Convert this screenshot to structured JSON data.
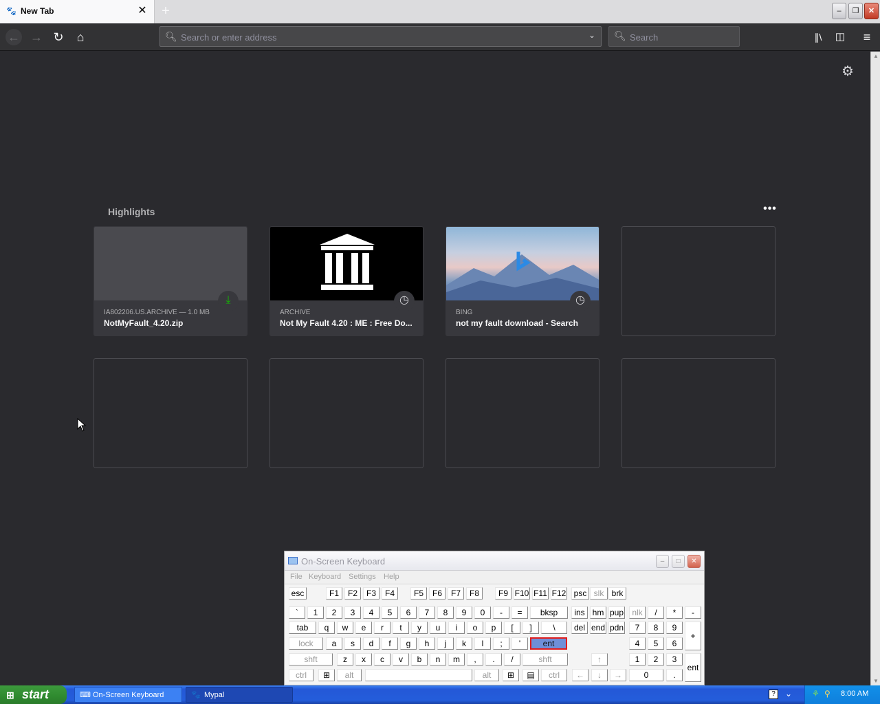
{
  "browser": {
    "tab": {
      "title": "New Tab",
      "close": "✕"
    },
    "new_tab": "+",
    "window_buttons": {
      "minimize": "‒",
      "restore": "❐",
      "close": "✕"
    },
    "nav": {
      "back": "←",
      "forward": "→",
      "reload": "↻",
      "home": "⌂"
    },
    "url_bar": {
      "value": "",
      "placeholder": "Search or enter address",
      "dropdown": "⌄"
    },
    "search_bar": {
      "value": "",
      "placeholder": "Search"
    },
    "toolbar": {
      "library": "∥\\",
      "sidebar": "◫",
      "menu": "≡"
    },
    "accent": "#0060df"
  },
  "newtab": {
    "settings": "⚙",
    "highlights_title": "Highlights",
    "more": "•••",
    "cards": [
      {
        "meta": "IA802206.US.ARCHIVE — 1.0 MB",
        "title": "NotMyFault_4.20.zip",
        "badge": "download-icon"
      },
      {
        "meta": "ARCHIVE",
        "title": "Not My Fault 4.20 : ME : Free Do...",
        "badge": "clock-icon"
      },
      {
        "meta": "BING",
        "title": "not my fault download - Search",
        "badge": "clock-icon"
      }
    ]
  },
  "osk": {
    "title": "On-Screen Keyboard",
    "menu": [
      "File",
      "Keyboard",
      "Settings",
      "Help"
    ],
    "rows": {
      "fn": [
        "esc",
        "F1",
        "F2",
        "F3",
        "F4",
        "F5",
        "F6",
        "F7",
        "F8",
        "F9",
        "F10",
        "F11",
        "F12",
        "psc",
        "slk",
        "brk"
      ],
      "num": [
        "`",
        "1",
        "2",
        "3",
        "4",
        "5",
        "6",
        "7",
        "8",
        "9",
        "0",
        "-",
        "=",
        "bksp",
        "ins",
        "hm",
        "pup",
        "nlk",
        "/",
        "*",
        "-"
      ],
      "top": [
        "tab",
        "q",
        "w",
        "e",
        "r",
        "t",
        "y",
        "u",
        "i",
        "o",
        "p",
        "[",
        "]",
        "\\",
        "del",
        "end",
        "pdn",
        "7",
        "8",
        "9",
        "+"
      ],
      "home": [
        "lock",
        "a",
        "s",
        "d",
        "f",
        "g",
        "h",
        "j",
        "k",
        "l",
        ";",
        "'",
        "ent",
        "4",
        "5",
        "6"
      ],
      "bottom": [
        "shft",
        "z",
        "x",
        "c",
        "v",
        "b",
        "n",
        "m",
        ",",
        ".",
        "/",
        "shft",
        "↑",
        "1",
        "2",
        "3",
        "ent"
      ],
      "space": [
        "ctrl",
        "⊞",
        "alt",
        "",
        "alt",
        "⊞",
        "▤",
        "ctrl",
        "←",
        "↓",
        "→",
        "0",
        "."
      ]
    }
  },
  "taskbar": {
    "start": "start",
    "items": [
      "On-Screen Keyboard",
      "Mypal"
    ],
    "clock": "8:00 AM",
    "help": "?"
  }
}
